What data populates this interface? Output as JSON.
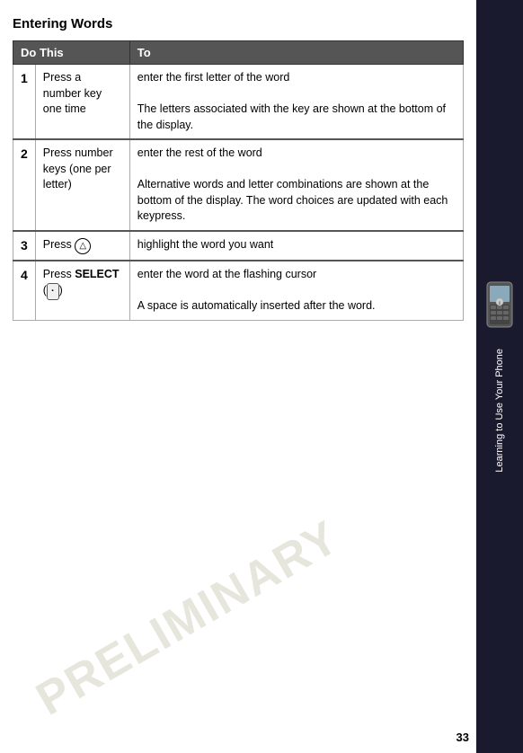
{
  "page": {
    "title": "Entering Words",
    "watermark": "PRELIMINARY",
    "page_number": "33"
  },
  "sidebar": {
    "text": "Learning to Use Your Phone"
  },
  "table": {
    "headers": [
      "Do This",
      "To"
    ],
    "rows": [
      {
        "step": "1",
        "do_this": "Press a number key one time",
        "to_parts": [
          "enter the first letter of the word",
          "The letters associated with the key are shown at the bottom of the display."
        ]
      },
      {
        "step": "2",
        "do_this": "Press number keys (one per letter)",
        "to_parts": [
          "enter the rest of the word",
          "Alternative words and letter combinations are shown at the bottom of the display. The word choices are updated with each keypress."
        ]
      },
      {
        "step": "3",
        "do_this_prefix": "Press ",
        "do_this_icon": "nav-icon",
        "to_parts": [
          "highlight the word you want"
        ]
      },
      {
        "step": "4",
        "do_this_prefix": "Press ",
        "do_this_select": "SELECT",
        "do_this_suffix": " (",
        "do_this_key": "·",
        "do_this_close": ")",
        "to_parts": [
          "enter the word at the flashing cursor",
          "A space is automatically inserted after the word."
        ]
      }
    ]
  }
}
